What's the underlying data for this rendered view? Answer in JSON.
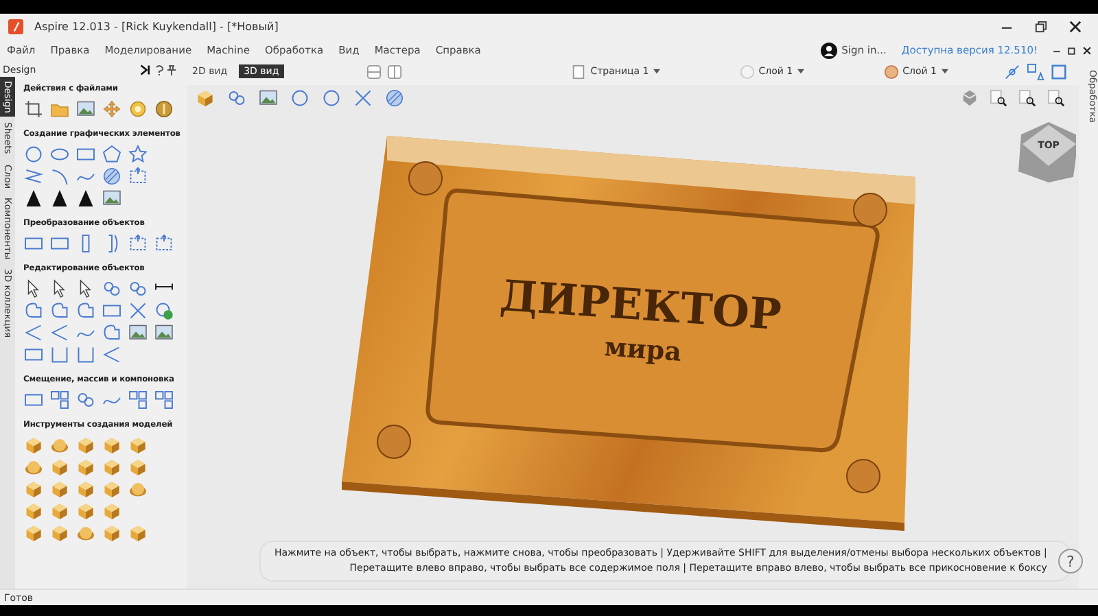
{
  "window": {
    "title": "Aspire 12.013 - [Rick Kuykendall] - [*Новый]"
  },
  "menu": [
    "Файл",
    "Правка",
    "Моделирование",
    "Machine",
    "Обработка",
    "Вид",
    "Мастера",
    "Справка"
  ],
  "account": {
    "sign_in": "Sign in...",
    "update": "Доступна версия 12.510!"
  },
  "panel": {
    "title": "Design",
    "tabs": [
      {
        "label": "Design",
        "selected": true
      },
      {
        "label": "Sheets",
        "selected": false
      },
      {
        "label": "Слои",
        "selected": false
      },
      {
        "label": "Компоненты",
        "selected": false
      },
      {
        "label": "3D коллекция",
        "selected": false
      }
    ],
    "sections": [
      {
        "title": "Действия с файлами"
      },
      {
        "title": "Создание графических элементов"
      },
      {
        "title": "Преобразование объектов"
      },
      {
        "title": "Редактирование объектов"
      },
      {
        "title": "Смещение, массив и компоновка"
      },
      {
        "title": "Инструменты создания моделей"
      }
    ]
  },
  "view_toggle": [
    {
      "label": "2D вид",
      "selected": false
    },
    {
      "label": "3D вид",
      "selected": true
    }
  ],
  "dropdowns": [
    "Страница 1",
    "Слой 1",
    "Слой 1"
  ],
  "sign": {
    "lines": [
      "ДИРЕКТОР",
      "мира"
    ]
  },
  "view_cube": {
    "label": "TOP"
  },
  "hint": {
    "lines": [
      "Нажмите на объект, чтобы выбрать, нажмите снова, чтобы преобразовать | Удерживайте SHIFT для выделения/отмены выбора нескольких объектов |",
      "Перетащите влево вправо, чтобы выбрать все содержимое поля | Перетащите вправо влево, чтобы выбрать все прикосновение к боксу"
    ],
    "help": "?"
  },
  "right_tab": "Обработка",
  "status": "Готов"
}
